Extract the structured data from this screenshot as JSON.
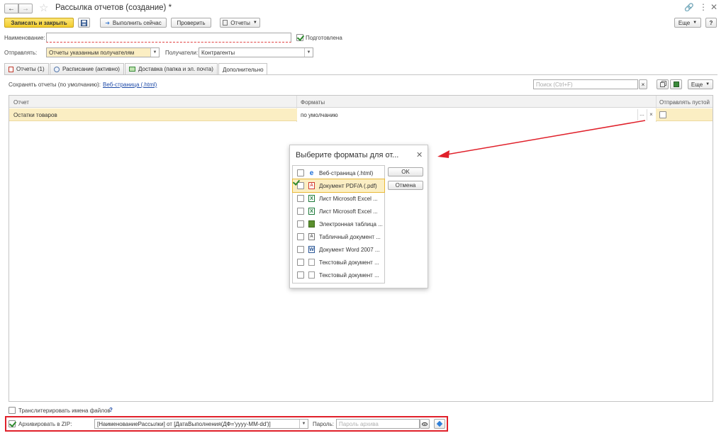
{
  "window": {
    "title": "Рассылка отчетов (создание) *",
    "more_label": "Еще",
    "help_label": "?"
  },
  "toolbar": {
    "save_close_label": "Записать и закрыть",
    "run_now_label": "Выполнить сейчас",
    "check_label": "Проверить",
    "reports_label": "Отчеты"
  },
  "form": {
    "name_label": "Наименование:",
    "name_value": "",
    "prepared_label": "Подготовлена",
    "send_label": "Отправлять:",
    "send_value": "Отчеты указанным получателям",
    "recipients_label": "Получатели:",
    "recipients_value": "Контрагенты"
  },
  "tabs": [
    {
      "label": "Отчеты (1)"
    },
    {
      "label": "Расписание (активно)"
    },
    {
      "label": "Доставка (папка и эл. почта)"
    },
    {
      "label": "Дополнительно"
    }
  ],
  "reports_panel": {
    "save_default_label": "Сохранять отчеты (по умолчанию):",
    "save_default_link": "Веб-страница (.html)",
    "search_placeholder": "Поиск (Ctrl+F)",
    "more_label": "Еще",
    "columns": [
      "Отчет",
      "Форматы",
      "Отправлять пустой"
    ],
    "rows": [
      {
        "report": "Остатки товаров",
        "formats": "по умолчанию",
        "send_empty": false
      }
    ]
  },
  "format_dialog": {
    "title": "Выберите форматы для от...",
    "ok_label": "OK",
    "cancel_label": "Отмена",
    "items": [
      {
        "label": "Веб-страница (.html)",
        "checked": false,
        "icon": "ie-icon"
      },
      {
        "label": "Документ PDF/A (.pdf)",
        "checked": true,
        "icon": "pdf-icon"
      },
      {
        "label": "Лист Microsoft Excel ...",
        "checked": false,
        "icon": "excel-icon"
      },
      {
        "label": "Лист Microsoft Excel ...",
        "checked": false,
        "icon": "excel-icon"
      },
      {
        "label": "Электронная таблица ...",
        "checked": false,
        "icon": "spreadsheet-icon"
      },
      {
        "label": "Табличный документ ...",
        "checked": false,
        "icon": "table-doc-icon"
      },
      {
        "label": "Документ Word 2007 ...",
        "checked": false,
        "icon": "word-icon"
      },
      {
        "label": "Текстовый документ ...",
        "checked": false,
        "icon": "text-doc-icon"
      },
      {
        "label": "Текстовый документ ...",
        "checked": false,
        "icon": "text-doc-icon"
      }
    ]
  },
  "footer": {
    "transliterate_label": "Транслитерировать имена файлов",
    "help_mark": "?",
    "zip_label": "Архивировать в ZIP:",
    "zip_value": "[НаименованиеРассылки] от [ДатаВыполнения(ДФ='yyyy-MM-dd')]",
    "password_label": "Пароль:",
    "password_placeholder": "Пароль архива"
  },
  "colors": {
    "primary_button": "#f5d33c",
    "selected_row": "#fbeec3",
    "highlight_red": "#e0202a"
  }
}
